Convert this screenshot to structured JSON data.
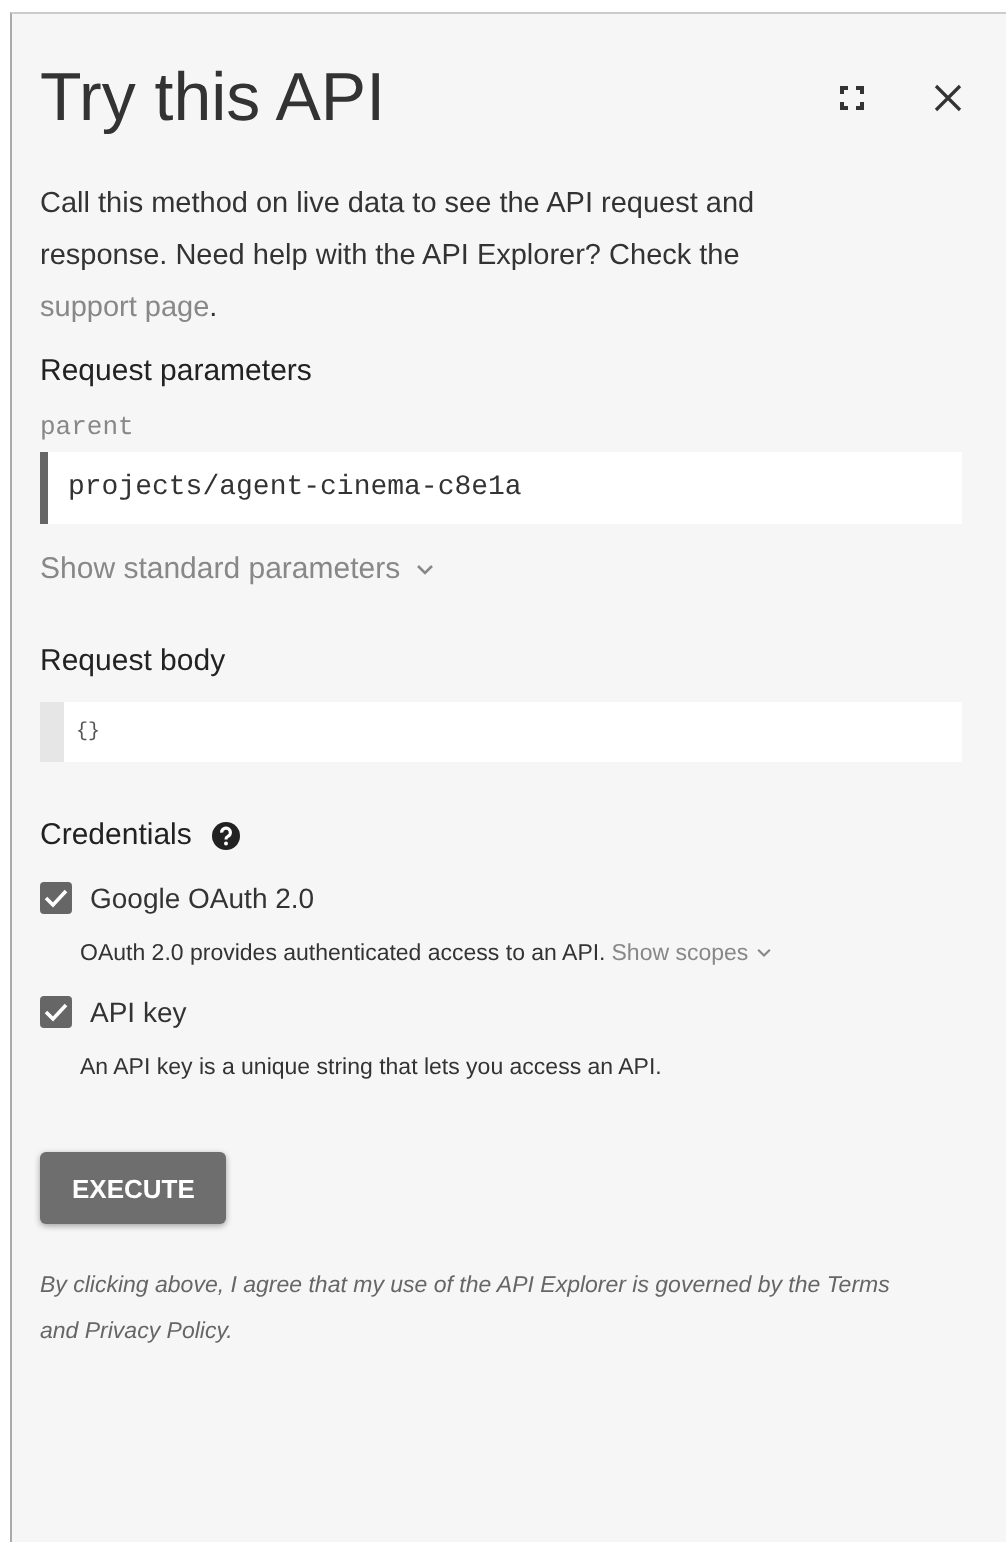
{
  "panel": {
    "title": "Try this API"
  },
  "intro": {
    "text": "Call this method on live data to see the API request and response. Need help with the API Explorer? Check the ",
    "link": "support page",
    "after": "."
  },
  "request_parameters": {
    "heading": "Request parameters",
    "fields": [
      {
        "label": "parent",
        "value": "projects/agent-cinema-c8e1a"
      }
    ],
    "toggle": "Show standard parameters"
  },
  "request_body": {
    "heading": "Request body",
    "value": "{}"
  },
  "credentials": {
    "heading": "Credentials",
    "items": [
      {
        "label": "Google OAuth 2.0",
        "checked": true,
        "description": "OAuth 2.0 provides authenticated access to an API.",
        "link": "Show scopes"
      },
      {
        "label": "API key",
        "checked": true,
        "description": "An API key is a unique string that lets you access an API."
      }
    ]
  },
  "execute_button": "EXECUTE",
  "footer": "By clicking above, I agree that my use of the API Explorer is governed by the Terms and Privacy Policy."
}
